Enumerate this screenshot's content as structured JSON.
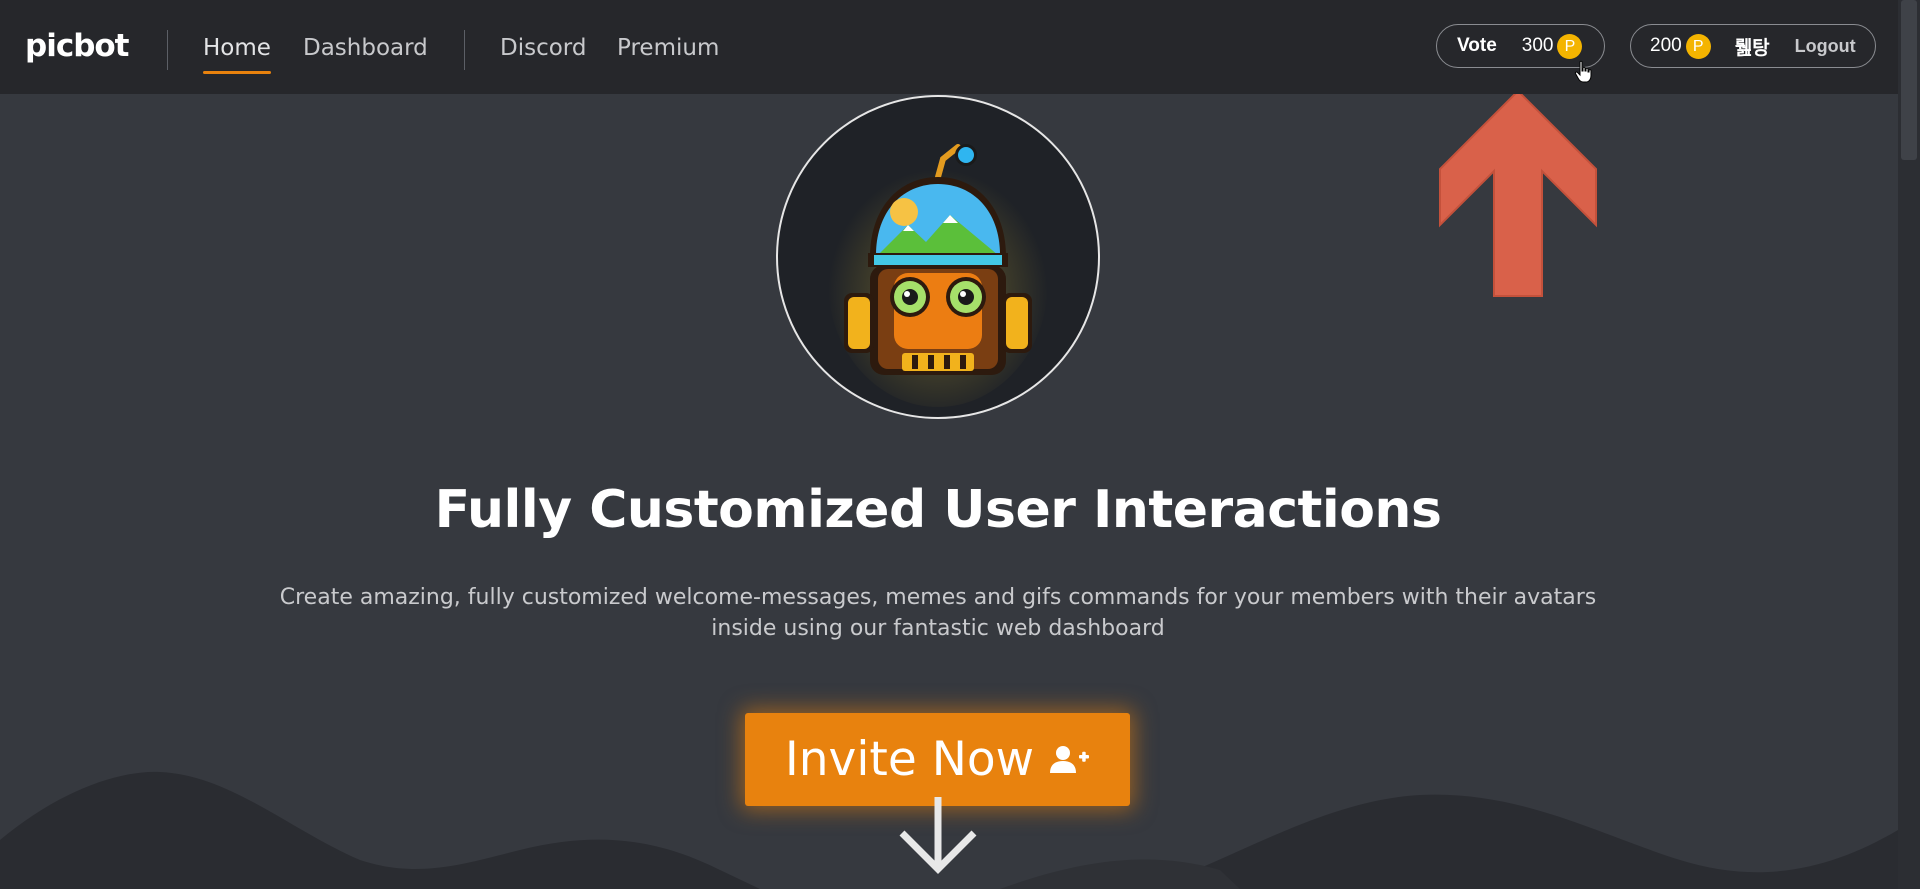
{
  "brand": {
    "logo": "picbot"
  },
  "nav": {
    "home": "Home",
    "dashboard": "Dashboard",
    "discord": "Discord",
    "premium": "Premium",
    "active": "home"
  },
  "vote_pill": {
    "label": "Vote",
    "points": "300",
    "coin_symbol": "P"
  },
  "user_pill": {
    "points": "200",
    "coin_symbol": "P",
    "username": "뤮탕",
    "logout": "Logout"
  },
  "hero": {
    "title": "Fully Customized User Interactions",
    "subtitle": "Create amazing, fully customized welcome-messages, memes and gifs commands for your members with their avatars inside using our fantastic web dashboard",
    "invite_button": "Invite Now"
  },
  "icons": {
    "coin": "coin-icon",
    "invite": "user-plus-icon",
    "scroll_down": "arrow-down-icon",
    "annotation": "red-up-arrow-icon",
    "mascot": "robot-mascot-icon",
    "cursor": "hand-pointer-cursor-icon"
  },
  "colors": {
    "background": "#36393f",
    "navbar": "#26272b",
    "accent": "#e8820e",
    "coin": "#f4b400",
    "annotation_arrow": "#d9614a"
  }
}
